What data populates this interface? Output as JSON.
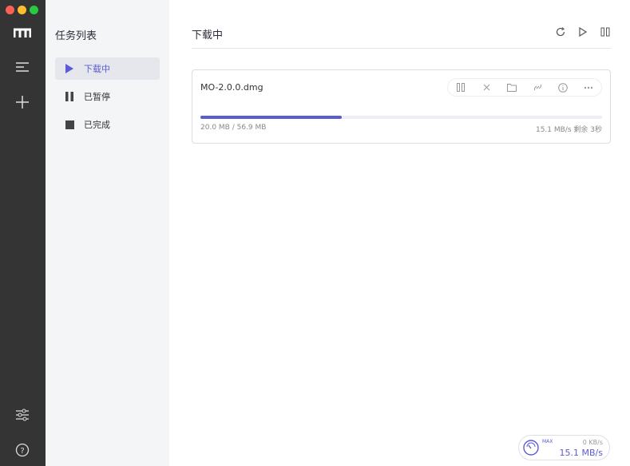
{
  "sidebar": {
    "title": "任务列表",
    "items": [
      {
        "label": "下载中",
        "active": true
      },
      {
        "label": "已暂停"
      },
      {
        "label": "已完成"
      }
    ]
  },
  "main": {
    "title": "下载中"
  },
  "task": {
    "name": "MO-2.0.0.dmg",
    "progress": 0.352,
    "size": "20.0 MB / 56.9 MB",
    "speed": "15.1 MB/s 剩余 3秒"
  },
  "speedometer": {
    "max_label": "MAX",
    "upload": "0 KB/s",
    "download": "15.1 MB/s"
  },
  "colors": {
    "accent": "#5b5bd6",
    "rail": "#343434"
  }
}
